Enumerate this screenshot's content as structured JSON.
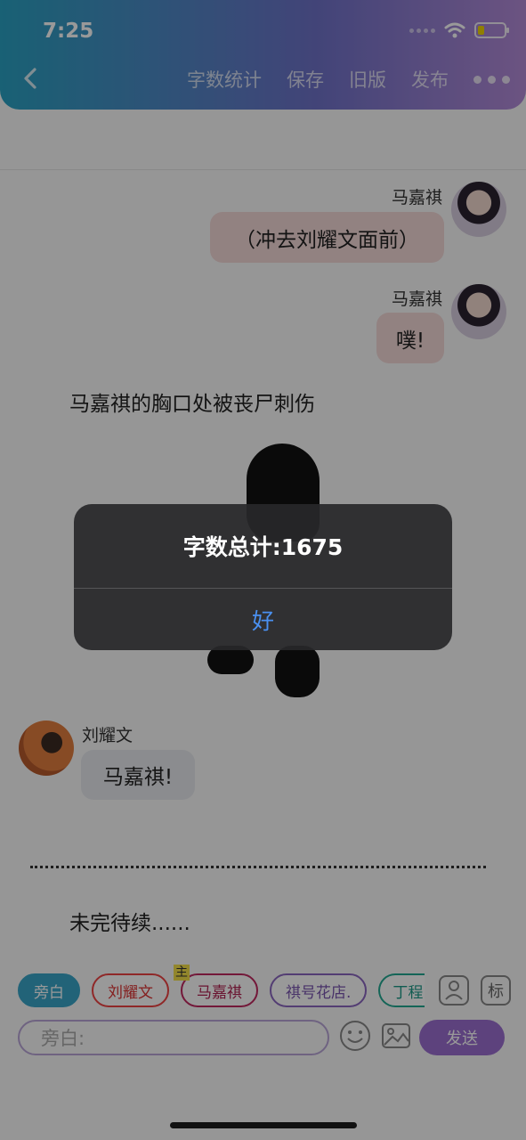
{
  "status_bar": {
    "time": "7:25",
    "battery_level": 0.25
  },
  "nav": {
    "actions": [
      "字数统计",
      "保存",
      "旧版",
      "发布"
    ],
    "icons": {
      "back": "chevron-left-icon",
      "more": "ellipsis-icon"
    }
  },
  "chat": {
    "msg1": {
      "name": "马嘉祺",
      "text": "（冲去刘耀文面前）"
    },
    "msg2": {
      "name": "马嘉祺",
      "text": "噗!"
    },
    "narration1": "马嘉祺的胸口处被丧尸刺伤",
    "msg3": {
      "name": "刘耀文",
      "text": "马嘉祺!"
    },
    "narration2": "未完待续......"
  },
  "alert": {
    "title": "字数总计:1675",
    "button": "好"
  },
  "composer": {
    "roles": [
      "旁白",
      "刘耀文",
      "马嘉祺",
      "祺号花店.",
      "丁程"
    ],
    "main_tag": "主",
    "tag_button": "标",
    "input_placeholder": "旁白:",
    "send_label": "发送"
  },
  "colors": {
    "header_start": "#2aa2c3",
    "header_end": "#b48bd8",
    "send": "#9b6fd1",
    "alert_button": "#4a90f0"
  }
}
